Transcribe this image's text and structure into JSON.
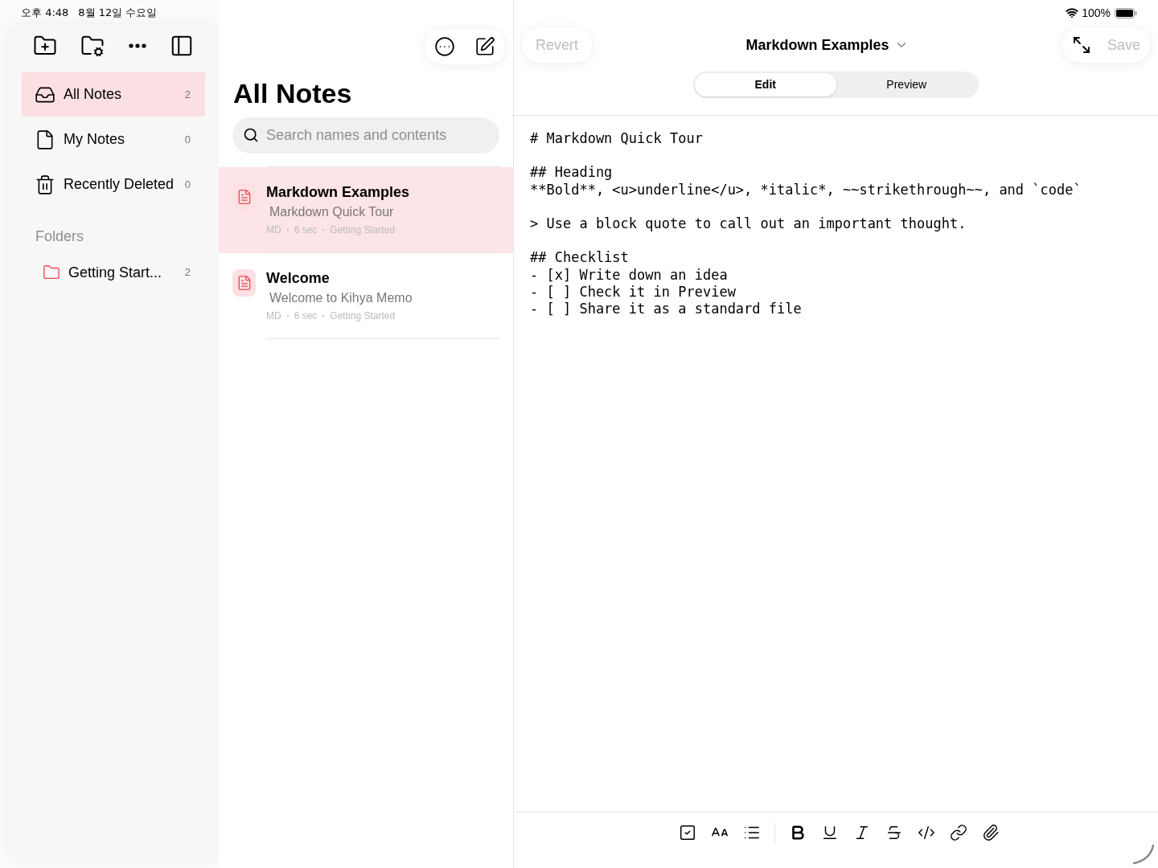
{
  "status_bar": {
    "time": "오후 4:48",
    "date": "8월 12일 수요일",
    "battery": "100%"
  },
  "sidebar": {
    "items": [
      {
        "kind": "inbox",
        "label": "All Notes",
        "count": "2",
        "selected": true
      },
      {
        "kind": "document",
        "label": "My Notes",
        "count": "0",
        "selected": false
      },
      {
        "kind": "trash",
        "label": "Recently Deleted",
        "count": "0",
        "selected": false
      }
    ],
    "folders_heading": "Folders",
    "folders": [
      {
        "label": "Getting Start...",
        "count": "2",
        "selected": false
      }
    ]
  },
  "note_list": {
    "title": "All Notes",
    "search": {
      "placeholder": "Search names and contents"
    },
    "notes": [
      {
        "title": "Markdown Examples",
        "preview": "Markdown Quick Tour",
        "format": "MD",
        "age": "6 sec",
        "folder": "Getting Started",
        "selected": true
      },
      {
        "title": "Welcome",
        "preview": "Welcome to Kihya Memo",
        "format": "MD",
        "age": "6 sec",
        "folder": "Getting Started",
        "selected": false
      }
    ]
  },
  "editor": {
    "revert": "Revert",
    "title": "Markdown Examples",
    "save": "Save",
    "tabs": [
      {
        "label": "Edit",
        "selected": true
      },
      {
        "label": "Preview",
        "selected": false
      }
    ],
    "paragraphs": [
      [
        "# Markdown Quick Tour"
      ],
      [
        "## Heading",
        "**Bold**, <u>underline</u>, *italic*, ~~strikethrough~~, and `code`"
      ],
      [
        "> Use a block quote to call out an important thought."
      ],
      [
        "## Checklist",
        "- [x] Write down an idea",
        "- [ ] Check it in Preview",
        "- [ ] Share it as a standard file"
      ]
    ]
  }
}
